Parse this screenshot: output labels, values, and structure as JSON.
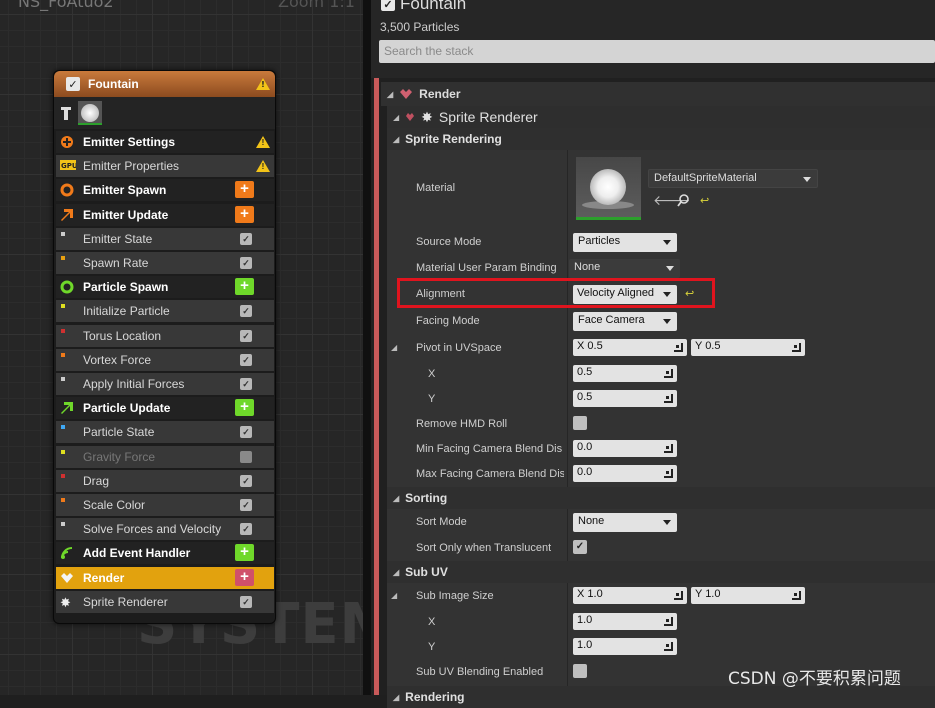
{
  "graph": {
    "title": "NS_FoAtuo2",
    "zoom": "Zoom 1:1",
    "watermark": "SYSTEM"
  },
  "node": {
    "title": "Fountain",
    "header_color": "#b8692f",
    "rows": [
      {
        "label": "Emitter Settings",
        "kind": "group",
        "icon": "emitter-settings-icon",
        "icon_color": "#f07a1a",
        "warn": true
      },
      {
        "label": "Emitter Properties",
        "kind": "module",
        "icon": "gpu-icon",
        "warn": true
      },
      {
        "label": "Emitter Spawn",
        "kind": "group",
        "icon": "emitter-spawn-icon",
        "icon_color": "#f07a1a",
        "plus_color": "#f07a1a"
      },
      {
        "label": "Emitter Update",
        "kind": "group",
        "icon": "emitter-update-icon",
        "icon_color": "#f07a1a",
        "plus_color": "#f07a1a"
      },
      {
        "label": "Emitter State",
        "kind": "module",
        "checked": true
      },
      {
        "label": "Spawn Rate",
        "kind": "module",
        "checked": true
      },
      {
        "label": "Particle Spawn",
        "kind": "group",
        "icon": "particle-spawn-icon",
        "icon_color": "#6fd82a",
        "plus_color": "#6fd82a"
      },
      {
        "label": "Initialize Particle",
        "kind": "module",
        "checked": true
      },
      {
        "label": "Torus Location",
        "kind": "module",
        "checked": true
      },
      {
        "label": "Vortex Force",
        "kind": "module",
        "checked": true
      },
      {
        "label": "Apply Initial Forces",
        "kind": "module",
        "checked": true
      },
      {
        "label": "Particle Update",
        "kind": "group",
        "icon": "particle-update-icon",
        "icon_color": "#6fd82a",
        "plus_color": "#6fd82a"
      },
      {
        "label": "Particle State",
        "kind": "module",
        "checked": true
      },
      {
        "label": "Gravity Force",
        "kind": "module",
        "checked": false,
        "disabled": true
      },
      {
        "label": "Drag",
        "kind": "module",
        "checked": true
      },
      {
        "label": "Scale Color",
        "kind": "module",
        "checked": true
      },
      {
        "label": "Solve Forces and Velocity",
        "kind": "module",
        "checked": true
      },
      {
        "label": "Add Event Handler",
        "kind": "group",
        "icon": "event-handler-icon",
        "icon_color": "#6fd82a",
        "plus_color": "#6fd82a"
      },
      {
        "label": "Render",
        "kind": "render",
        "icon": "render-icon",
        "plus_color": "#d0506a"
      },
      {
        "label": "Sprite Renderer",
        "kind": "module",
        "icon": "sprite-renderer-icon",
        "checked": true
      }
    ]
  },
  "panel": {
    "title": "Fountain",
    "subtitle": "3,500 Particles",
    "search_placeholder": "Search the stack",
    "render_header": "Render",
    "sprite_header": "Sprite Renderer",
    "sections": {
      "sprite_rendering": "Sprite Rendering",
      "sorting": "Sorting",
      "sub_uv": "Sub UV",
      "rendering": "Rendering"
    },
    "material": {
      "label": "Material",
      "value": "DefaultSpriteMaterial"
    },
    "source_mode": {
      "label": "Source Mode",
      "value": "Particles"
    },
    "material_user_param": {
      "label": "Material User Param Binding",
      "value": "None"
    },
    "alignment": {
      "label": "Alignment",
      "value": "Velocity Aligned"
    },
    "facing_mode": {
      "label": "Facing Mode",
      "value": "Face Camera"
    },
    "pivot": {
      "label": "Pivot in UVSpace",
      "x_text": "X  0.5",
      "y_text": "Y  0.5",
      "x_label": "X",
      "y_label": "Y",
      "x": "0.5",
      "y": "0.5"
    },
    "remove_hmd_roll": {
      "label": "Remove HMD Roll",
      "checked": false
    },
    "min_facing": {
      "label": "Min Facing Camera Blend Dis",
      "value": "0.0"
    },
    "max_facing": {
      "label": "Max Facing Camera Blend Dis",
      "value": "0.0"
    },
    "sort_mode": {
      "label": "Sort Mode",
      "value": "None"
    },
    "sort_only_translucent": {
      "label": "Sort Only when Translucent",
      "checked": true
    },
    "sub_image_size": {
      "label": "Sub Image Size",
      "x_text": "X  1.0",
      "y_text": "Y  1.0",
      "x_label": "X",
      "y_label": "Y",
      "x": "1.0",
      "y": "1.0"
    },
    "sub_uv_blending": {
      "label": "Sub UV Blending Enabled",
      "checked": false
    }
  },
  "watermark_text": "CSDN @不要积累问题",
  "highlight_color": "#e0141e"
}
